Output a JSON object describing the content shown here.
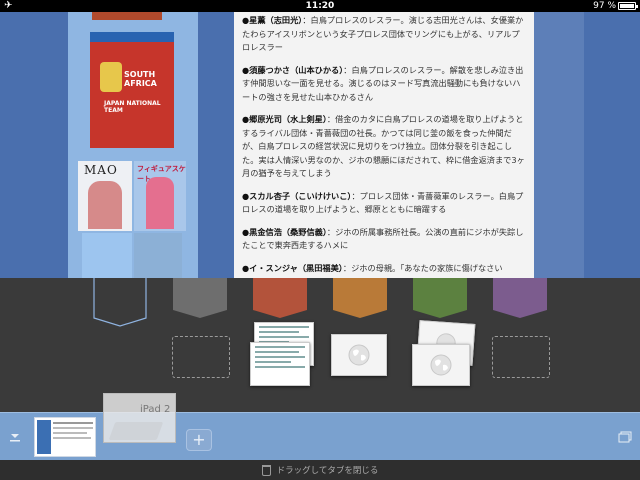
{
  "status_bar": {
    "airplane_icon": "airplane-icon",
    "time": "11:20",
    "battery_percent": "97 %",
    "battery_level": 0.97
  },
  "web_page": {
    "book_sa": {
      "line1": "SOUTH\nAFRICA",
      "line2": "JAPAN NATIONAL TEAM"
    },
    "book_mao": {
      "title": "MAO"
    },
    "book_skate": {
      "title": "フィギュアスケート"
    },
    "article": [
      {
        "name": "●星薫（志田光）",
        "text": "：白鳥プロレスのレスラー。演じる志田光さんは、女優業かたわらアイスリボンという女子プロレス団体でリングにも上がる、リアルプロレスラー"
      },
      {
        "name": "●須藤つかさ（山本ひかる）",
        "text": "：白鳥プロレスのレスラー。解散を悲しみ泣き出す仲間思いな一面を見せる。演じるのはヌード写真流出騒動にも負けないハートの強さを見せた山本ひかるさん"
      },
      {
        "name": "●郷原光司（水上剣星）",
        "text": "：借金のカタに白鳥プロレスの道場を取り上げようとするライバル団体・青薔薇団の社長。かつては同じ釜の飯を食った仲間だが、白鳥プロレスの経営状況に見切りをつけ独立。団体分裂を引き起こした。実は人情深い男なのか、ジホの懇願にほだされて、枠に借金返済まで3ヶ月の猶予を与えてしまう"
      },
      {
        "name": "●スカル杏子（こいけけいこ）",
        "text": "：プロレス団体・青薔薇軍のレスラー。白鳥プロレスの道場を取り上げようと、郷原とともに暗躍する"
      },
      {
        "name": "●黒金信浩（桑野信義）",
        "text": "：ジホの所属事務所社長。公演の直前にジホが失踪したことで東奔西走するハメに"
      },
      {
        "name": "●イ・スンジャ（黒田福美）",
        "text": "：ジホの母親。「あなたの家族に傷げなさい"
      }
    ]
  },
  "tab_manager": {
    "flags": [
      {
        "name": "flag-outline",
        "color": "none"
      },
      {
        "name": "flag-gray",
        "color": "#6e6e6e"
      },
      {
        "name": "flag-red",
        "color": "#b3533b"
      },
      {
        "name": "flag-orange",
        "color": "#b97a38"
      },
      {
        "name": "flag-green",
        "color": "#5c8140"
      },
      {
        "name": "flag-purple",
        "color": "#7c5c8e"
      }
    ]
  },
  "tab_bar": {
    "left_icon": "collapse-icon",
    "right_icon": "tab-list-icon",
    "dragging_tab_label": "iPad 2",
    "add_button_label": "+"
  },
  "bottom_hint": "ドラッグしてタブを閉じる"
}
